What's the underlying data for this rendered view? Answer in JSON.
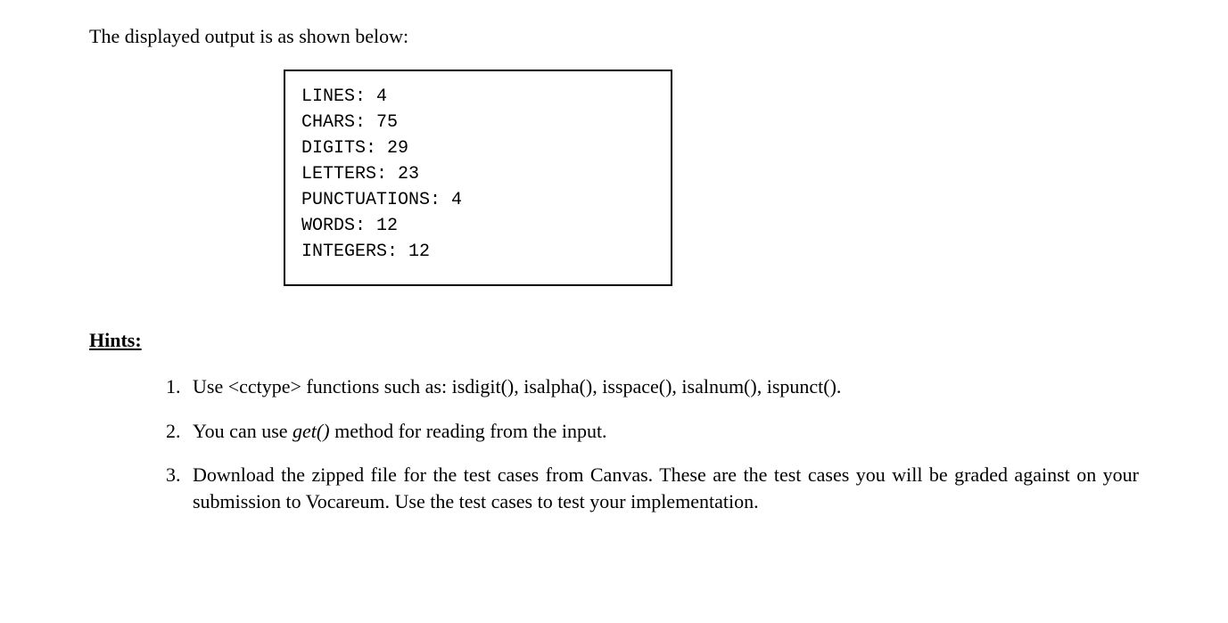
{
  "intro": "The displayed output is as shown below:",
  "output": {
    "lines": [
      "LINES: 4",
      "CHARS: 75",
      "DIGITS: 29",
      "LETTERS: 23",
      "PUNCTUATIONS: 4",
      "WORDS: 12",
      "INTEGERS: 12"
    ]
  },
  "hints_heading": "Hints:",
  "hints": {
    "item1": "Use <cctype> functions such as: isdigit(), isalpha(), isspace(), isalnum(), ispunct().",
    "item2_pre": "You can use ",
    "item2_italic": "get()",
    "item2_post": " method for reading from the input.",
    "item3": "Download the zipped file for the test cases from Canvas. These are the test cases you will be graded against on your submission to Vocareum. Use the test cases to test your implementation."
  }
}
